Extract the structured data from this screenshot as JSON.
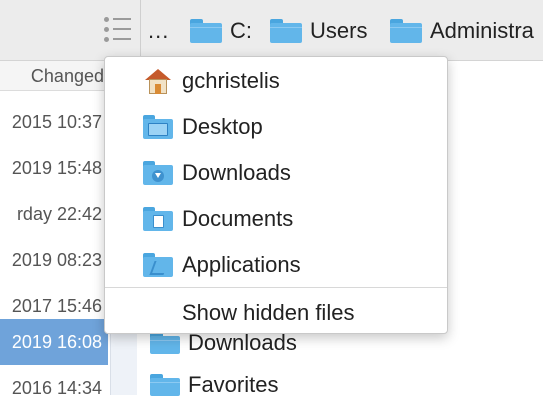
{
  "toolbar": {
    "menu_icon": "list-menu-icon",
    "breadcrumb_overflow": "...",
    "breadcrumbs": [
      {
        "label": "C:",
        "icon": "folder-icon"
      },
      {
        "label": "Users",
        "icon": "folder-icon"
      },
      {
        "label": "Administra",
        "icon": "folder-icon"
      }
    ]
  },
  "file_list": {
    "column_header": "Changed",
    "rows": [
      {
        "changed": "2015 10:37",
        "selected": false
      },
      {
        "changed": "2019 15:48",
        "selected": false
      },
      {
        "changed": "rday 22:42",
        "selected": false
      },
      {
        "changed": "2019 08:23",
        "selected": false
      },
      {
        "changed": "2017 15:46",
        "selected": false
      },
      {
        "changed": "2019 16:08",
        "selected": true
      },
      {
        "changed": "2016 14:34",
        "selected": false
      }
    ],
    "selected_row_color": "#6fa3da"
  },
  "folder_list": {
    "items": [
      {
        "label": "Downloads",
        "icon": "folder-icon"
      },
      {
        "label": "Favorites",
        "icon": "folder-icon"
      }
    ]
  },
  "dropdown": {
    "items": [
      {
        "label": "gchristelis",
        "icon": "home-icon"
      },
      {
        "label": "Desktop",
        "icon": "desktop-folder-icon"
      },
      {
        "label": "Downloads",
        "icon": "downloads-folder-icon"
      },
      {
        "label": "Documents",
        "icon": "documents-folder-icon"
      },
      {
        "label": "Applications",
        "icon": "applications-folder-icon"
      }
    ],
    "show_hidden_label": "Show hidden files"
  },
  "colors": {
    "folder_blue": "#62b6ea",
    "toolbar_bg": "#ececec"
  }
}
